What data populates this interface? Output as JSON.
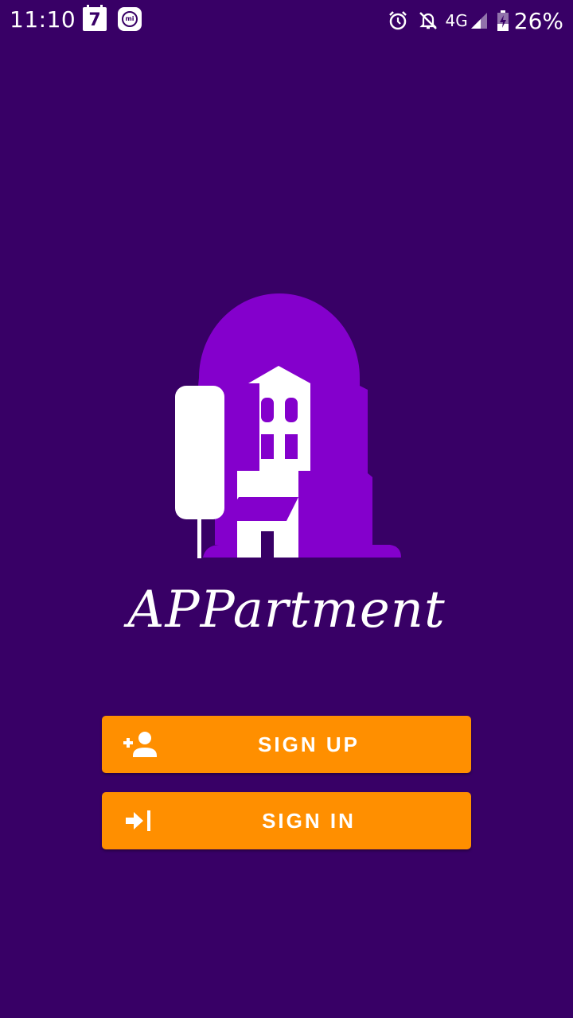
{
  "status_bar": {
    "time": "11:10",
    "calendar_day": "7",
    "network": "4G",
    "battery": "26%",
    "icons": [
      "calendar-icon",
      "mi-app-icon",
      "alarm-icon",
      "notifications-off-icon",
      "signal-icon",
      "battery-charging-icon"
    ]
  },
  "app": {
    "title": "APPartment",
    "logo": "apartment-logo"
  },
  "buttons": {
    "signup": {
      "label": "SIGN UP",
      "icon": "person-add-icon"
    },
    "signin": {
      "label": "SIGN IN",
      "icon": "login-icon"
    }
  },
  "colors": {
    "background": "#380066",
    "accent": "#ff8f00",
    "logo_purple": "#8400cc",
    "text": "#ffffff"
  }
}
